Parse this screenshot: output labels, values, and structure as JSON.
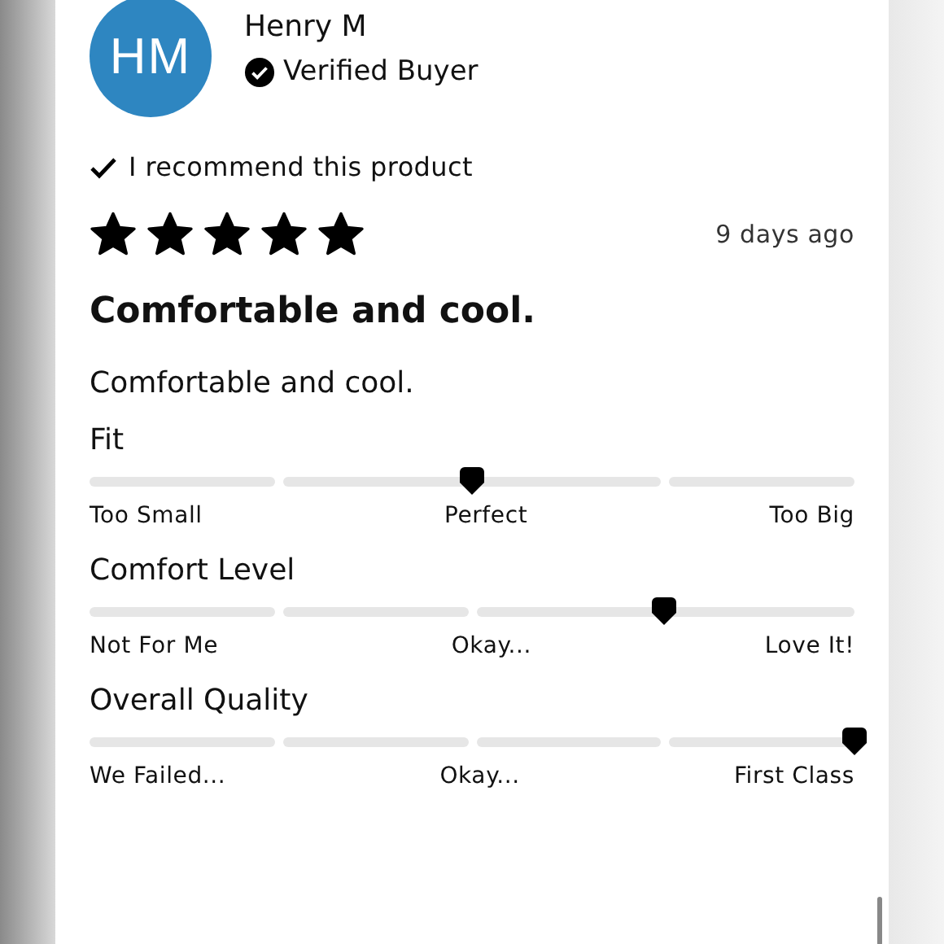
{
  "reviewer": {
    "initials": "HM",
    "name": "Henry M",
    "badge": "Verified Buyer"
  },
  "recommendation": {
    "recommended": true,
    "text": "I recommend this product"
  },
  "rating": {
    "stars": 5,
    "date": "9 days ago"
  },
  "title": "Comfortable and cool.",
  "body": "Comfortable and cool.",
  "sliders": [
    {
      "label": "Fit",
      "level": 0.5,
      "ticks": [
        "Too Small",
        "Perfect",
        "Too Big"
      ]
    },
    {
      "label": "Comfort Level",
      "level": 0.75,
      "ticks": [
        "Not For Me",
        "Okay...",
        "Love It!"
      ]
    },
    {
      "label": "Overall Quality",
      "level": 1,
      "ticks": [
        "We Failed...",
        "Okay...",
        "First Class"
      ]
    }
  ]
}
